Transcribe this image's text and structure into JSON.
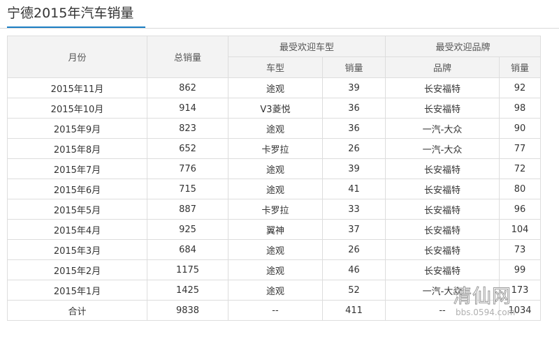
{
  "page": {
    "title": "宁德2015年汽车销量",
    "accent_color": "#1a7ec3"
  },
  "table": {
    "headers": {
      "month": "月份",
      "total": "总销量",
      "popular_model_group": "最受欢迎车型",
      "model": "车型",
      "model_sales": "销量",
      "popular_brand_group": "最受欢迎品牌",
      "brand": "品牌",
      "brand_sales": "销量"
    },
    "rows": [
      {
        "month": "2015年11月",
        "total": "862",
        "model": "途观",
        "model_sales": "39",
        "brand": "长安福特",
        "brand_sales": "92"
      },
      {
        "month": "2015年10月",
        "total": "914",
        "model": "V3菱悦",
        "model_sales": "36",
        "brand": "长安福特",
        "brand_sales": "98"
      },
      {
        "month": "2015年9月",
        "total": "823",
        "model": "途观",
        "model_sales": "36",
        "brand": "一汽-大众",
        "brand_sales": "90"
      },
      {
        "month": "2015年8月",
        "total": "652",
        "model": "卡罗拉",
        "model_sales": "26",
        "brand": "一汽-大众",
        "brand_sales": "77"
      },
      {
        "month": "2015年7月",
        "total": "776",
        "model": "途观",
        "model_sales": "39",
        "brand": "长安福特",
        "brand_sales": "72"
      },
      {
        "month": "2015年6月",
        "total": "715",
        "model": "途观",
        "model_sales": "41",
        "brand": "长安福特",
        "brand_sales": "80"
      },
      {
        "month": "2015年5月",
        "total": "887",
        "model": "卡罗拉",
        "model_sales": "33",
        "brand": "长安福特",
        "brand_sales": "96"
      },
      {
        "month": "2015年4月",
        "total": "925",
        "model": "翼神",
        "model_sales": "37",
        "brand": "长安福特",
        "brand_sales": "104"
      },
      {
        "month": "2015年3月",
        "total": "684",
        "model": "途观",
        "model_sales": "26",
        "brand": "长安福特",
        "brand_sales": "73"
      },
      {
        "month": "2015年2月",
        "total": "1175",
        "model": "途观",
        "model_sales": "46",
        "brand": "长安福特",
        "brand_sales": "99"
      },
      {
        "month": "2015年1月",
        "total": "1425",
        "model": "途观",
        "model_sales": "52",
        "brand": "一汽-大众",
        "brand_sales": "173"
      },
      {
        "month": "合计",
        "total": "9838",
        "model": "--",
        "model_sales": "411",
        "brand": "--",
        "brand_sales": "1034"
      }
    ]
  },
  "watermark": {
    "main": "清仙网",
    "sub": "bbs.0594.com"
  }
}
